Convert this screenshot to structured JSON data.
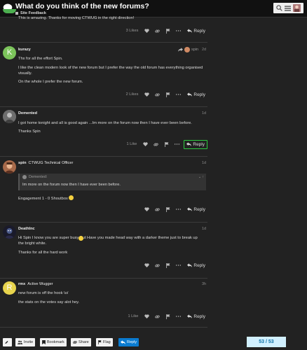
{
  "topic": {
    "title": "What do you think of the new forums?",
    "category": "Site Feedback"
  },
  "header_icons": [
    "search-icon",
    "menu-icon",
    "user-avatar"
  ],
  "posts": [
    {
      "text": [
        "This is amazing. Thanks for moving CTWUG in the right direction!"
      ],
      "likes": "3 Likes",
      "reply_label": "Reply"
    },
    {
      "username": "kurazy",
      "avatar_letter": "K",
      "avatar_color": "#7cc45b",
      "date": "2d",
      "reply_to": "spin",
      "text": [
        "Thx for all the effort Spin.",
        "I like the clean modern look of the new forum but I prefer the way the old forum has everything organised visually.",
        "On the whole I prefer the new forum."
      ],
      "likes": "2 Likes",
      "reply_label": "Reply"
    },
    {
      "username": "Demented",
      "date": "1d",
      "text": [
        "I got home tonight and all is good again ...Im more on the forum now then I have ever been before.",
        "Thanks Spin"
      ],
      "likes": "1 Like",
      "reply_label": "Reply"
    },
    {
      "username": "spin",
      "user_title": "CTWUG Technical Officer",
      "date": "1d",
      "quote_author": "Demented:",
      "quote_text": "Im more on the forum now then I have ever been before.",
      "text": [
        "Engagement 1 - 0 Shoutbox"
      ],
      "reply_label": "Reply"
    },
    {
      "username": "DeathInc",
      "date": "1d",
      "text": [
        "Hi Spin I know you are super busy  But Have you made head way with a darker theme just to break up the bright white.",
        "Thanks for all the hard work"
      ],
      "reply_label": "Reply"
    },
    {
      "username": "rmx",
      "user_title": "Active Wugger",
      "avatar_letter": "R",
      "avatar_color": "#e8d44d",
      "date": "3h",
      "text": [
        "new forum is off the hook \\o/",
        "the stats on the votes say alot hey."
      ],
      "likes": "1 Like",
      "reply_label": "Reply"
    }
  ],
  "bottom_bar": {
    "invite": "Invite",
    "bookmark": "Bookmark",
    "share": "Share",
    "flag": "Flag",
    "reply": "Reply",
    "progress": "53 / 53"
  },
  "colors": {
    "background": "#222222",
    "header": "#111111",
    "accent_blue": "#0a7bd0",
    "highlight_green": "#2ecc40",
    "progress_bg": "#d1f0ff"
  }
}
